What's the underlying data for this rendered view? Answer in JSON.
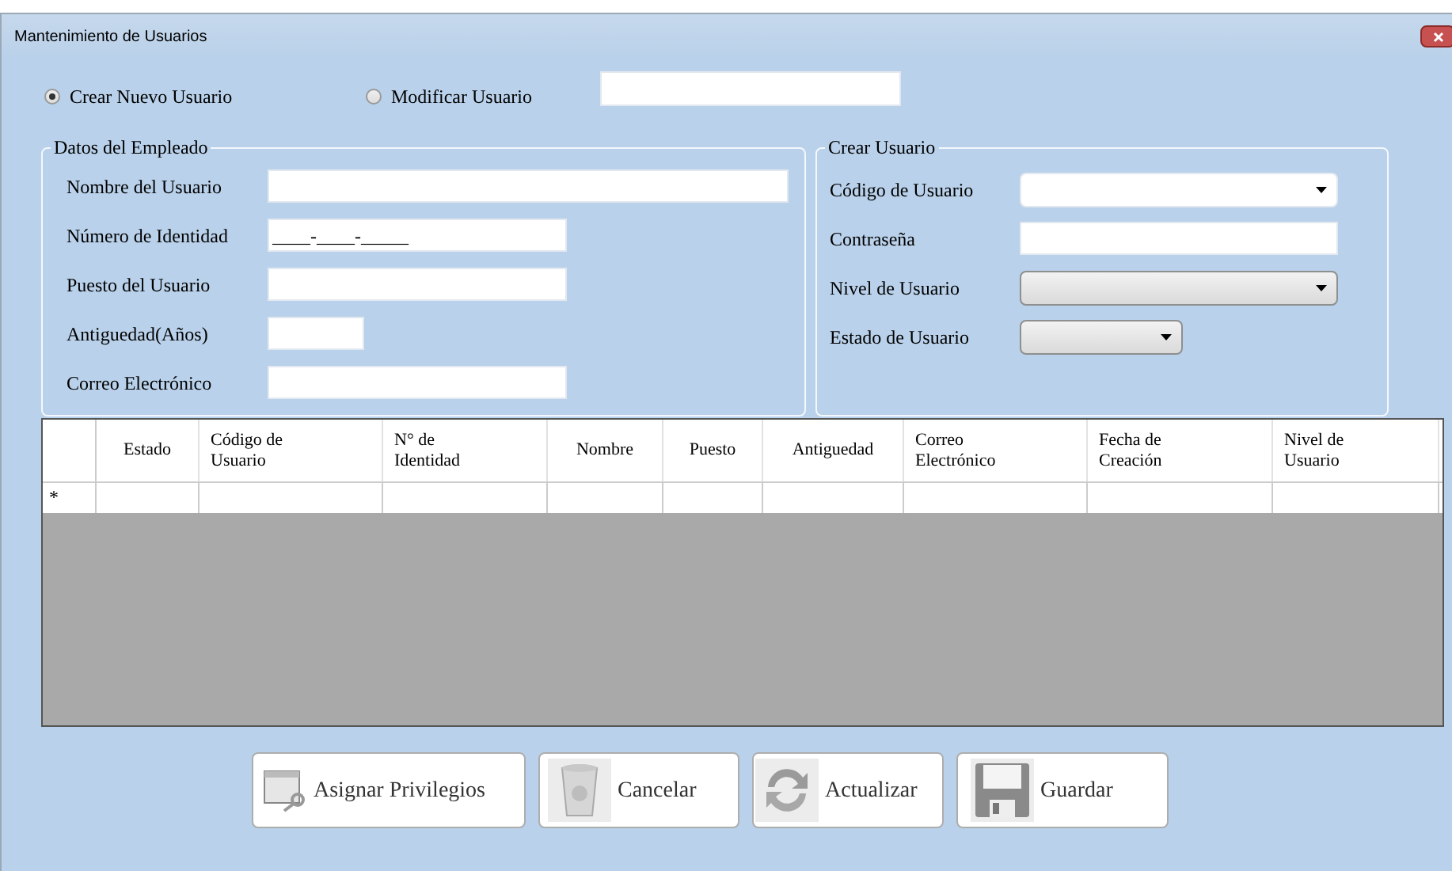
{
  "window": {
    "title": "Mantenimiento de Usuarios"
  },
  "mode_options": [
    {
      "label": "Crear Nuevo Usuario",
      "selected": true
    },
    {
      "label": "Modificar Usuario",
      "selected": false
    }
  ],
  "employee_group": {
    "title": "Datos del Empleado",
    "fields": [
      {
        "label": "Nombre del Usuario",
        "kind": "text"
      },
      {
        "label": "Número de Identidad",
        "kind": "masked",
        "value": "____-____-_____"
      },
      {
        "label": "Puesto del Usuario",
        "kind": "text"
      },
      {
        "label": "Antiguedad(Años)",
        "kind": "text"
      },
      {
        "label": "Correo Electrónico",
        "kind": "text"
      }
    ]
  },
  "user_group": {
    "title": "Crear Usuario",
    "fields": [
      {
        "label": "Código de Usuario",
        "kind": "combo"
      },
      {
        "label": "Contraseña",
        "kind": "text"
      },
      {
        "label": "Nivel de Usuario",
        "kind": "dropdown"
      },
      {
        "label": "Estado de Usuario",
        "kind": "dropdown"
      }
    ]
  },
  "table": {
    "columns": [
      "Estado",
      "Código de\nUsuario",
      "N° de\nIdentidad",
      "Nombre",
      "Puesto",
      "Antiguedad",
      "Correo\nElectrónico",
      "Fecha de\nCreación",
      "Nivel de\nUsuario"
    ],
    "new_row_marker": "*"
  },
  "buttons": [
    {
      "label": "Asignar Privilegios",
      "kind": "privileges"
    },
    {
      "label": "Cancelar",
      "kind": "trash"
    },
    {
      "label": "Actualizar",
      "kind": "refresh"
    },
    {
      "label": "Guardar",
      "kind": "save"
    }
  ]
}
